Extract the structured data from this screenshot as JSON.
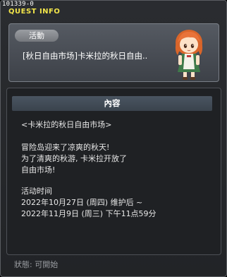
{
  "quest_id": "101339-0",
  "window_title": "QUEST INFO",
  "category_tag": "活動",
  "event_title": "[秋日自由市场]卡米拉的秋日自由..",
  "content_header": "內容",
  "content": {
    "subtitle": "<卡米拉的秋日自由市场>",
    "line1": "冒险岛迎来了凉爽的秋天!",
    "line2": "为了清爽的秋游, 卡米拉开放了",
    "line3": "自由市场!",
    "time_label": "活动时间",
    "time_start": "2022年10月27日 (周四) 维护后  ~",
    "time_end": "2022年11月9日 (周三) 下午11点59分"
  },
  "status_text": "狀態: 可開始"
}
